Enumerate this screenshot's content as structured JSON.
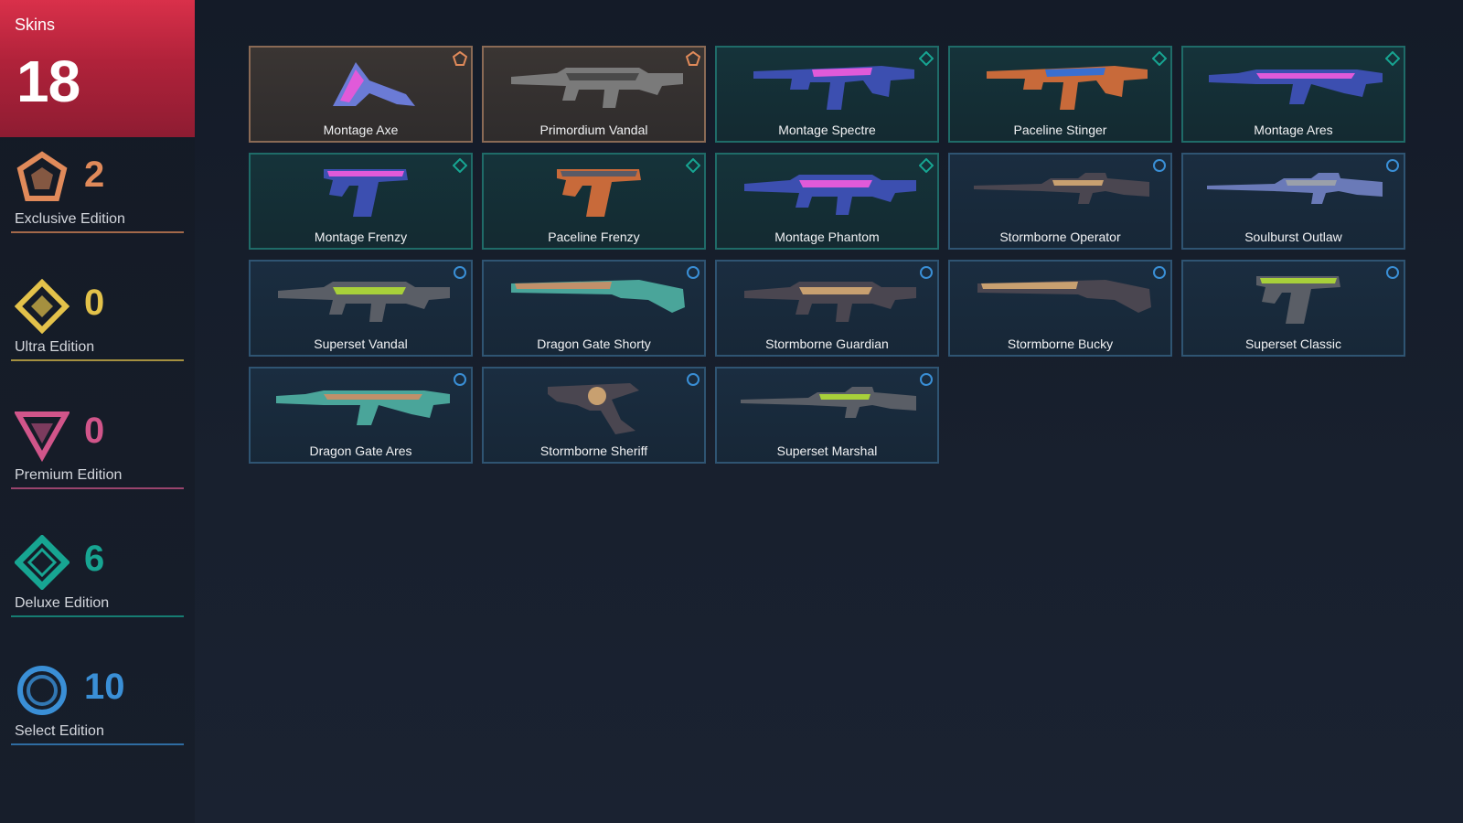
{
  "sidebar": {
    "total": {
      "label": "Skins",
      "count": "18"
    },
    "tiers": [
      {
        "name": "Exclusive Edition",
        "count": "2",
        "color": "#e08a5a",
        "icon": "exclusive-edition-icon"
      },
      {
        "name": "Ultra Edition",
        "count": "0",
        "color": "#e3c24a",
        "icon": "ultra-edition-icon"
      },
      {
        "name": "Premium Edition",
        "count": "0",
        "color": "#d1558a",
        "icon": "premium-edition-icon"
      },
      {
        "name": "Deluxe Edition",
        "count": "6",
        "color": "#17a592",
        "icon": "deluxe-edition-icon"
      },
      {
        "name": "Select Edition",
        "count": "10",
        "color": "#3a8fd6",
        "icon": "select-edition-icon"
      }
    ]
  },
  "skins": [
    {
      "name": "Montage Axe",
      "tier": "exclusive",
      "weapon": "melee",
      "colors": [
        "#6b7bd6",
        "#e05ad9"
      ]
    },
    {
      "name": "Primordium Vandal",
      "tier": "exclusive",
      "weapon": "rifle",
      "colors": [
        "#7a7a7a",
        "#4a4a4a"
      ]
    },
    {
      "name": "Montage Spectre",
      "tier": "deluxe",
      "weapon": "smg",
      "colors": [
        "#3c4fb0",
        "#e05ad9"
      ]
    },
    {
      "name": "Paceline Stinger",
      "tier": "deluxe",
      "weapon": "smg",
      "colors": [
        "#c86a3a",
        "#3a6fd0"
      ]
    },
    {
      "name": "Montage Ares",
      "tier": "deluxe",
      "weapon": "heavy",
      "colors": [
        "#3c4fb0",
        "#e05ad9"
      ]
    },
    {
      "name": "Montage Frenzy",
      "tier": "deluxe",
      "weapon": "pistol",
      "colors": [
        "#3c4fb0",
        "#e05ad9"
      ]
    },
    {
      "name": "Paceline Frenzy",
      "tier": "deluxe",
      "weapon": "pistol",
      "colors": [
        "#c86a3a",
        "#5a5a66"
      ]
    },
    {
      "name": "Montage Phantom",
      "tier": "deluxe",
      "weapon": "rifle",
      "colors": [
        "#3c4fb0",
        "#e05ad9"
      ]
    },
    {
      "name": "Stormborne Operator",
      "tier": "select",
      "weapon": "sniper",
      "colors": [
        "#4a4650",
        "#c8a070"
      ]
    },
    {
      "name": "Soulburst Outlaw",
      "tier": "select",
      "weapon": "sniper",
      "colors": [
        "#6a7ab8",
        "#9aa0aa"
      ]
    },
    {
      "name": "Superset Vandal",
      "tier": "select",
      "weapon": "rifle",
      "colors": [
        "#5a5e66",
        "#a8d03a"
      ]
    },
    {
      "name": "Dragon Gate Shorty",
      "tier": "select",
      "weapon": "shotgun",
      "colors": [
        "#4aa59a",
        "#c0906a"
      ]
    },
    {
      "name": "Stormborne Guardian",
      "tier": "select",
      "weapon": "rifle",
      "colors": [
        "#4a4650",
        "#c8a070"
      ]
    },
    {
      "name": "Stormborne Bucky",
      "tier": "select",
      "weapon": "shotgun",
      "colors": [
        "#4a4650",
        "#c8a070"
      ]
    },
    {
      "name": "Superset Classic",
      "tier": "select",
      "weapon": "pistol",
      "colors": [
        "#5a5e66",
        "#a8d03a"
      ]
    },
    {
      "name": "Dragon Gate Ares",
      "tier": "select",
      "weapon": "heavy",
      "colors": [
        "#4aa59a",
        "#c0906a"
      ]
    },
    {
      "name": "Stormborne Sheriff",
      "tier": "select",
      "weapon": "revolver",
      "colors": [
        "#4a4650",
        "#c8a070"
      ]
    },
    {
      "name": "Superset Marshal",
      "tier": "select",
      "weapon": "sniper",
      "colors": [
        "#5a5e66",
        "#a8d03a"
      ]
    }
  ]
}
